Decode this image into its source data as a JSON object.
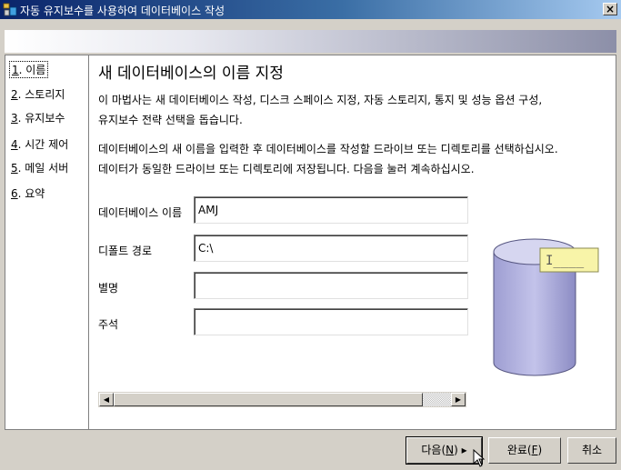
{
  "window": {
    "title": "자동 유지보수를 사용하여 데이터베이스 작성",
    "close": "×"
  },
  "nav": {
    "items": [
      {
        "num": "1",
        "label": ". 이름"
      },
      {
        "num": "2",
        "label": ". 스토리지"
      },
      {
        "num": "3",
        "label": ". 유지보수"
      },
      {
        "num": "4",
        "label": ". 시간 제어"
      },
      {
        "num": "5",
        "label": ". 메일 서버"
      },
      {
        "num": "6",
        "label": ". 요약"
      }
    ]
  },
  "main": {
    "heading": "새 데이터베이스의 이름 지정",
    "intro_line1": "이 마법사는 새 데이터베이스 작성, 디스크 스페이스 지정, 자동 스토리지, 통지 및 성능 옵션 구성,",
    "intro_line2": "유지보수 전략 선택을 돕습니다.",
    "instr_line1": "데이터베이스의 새 이름을 입력한 후 데이터베이스를 작성할 드라이브 또는 디렉토리를 선택하십시오.",
    "instr_line2": "데이터가 동일한 드라이브 또는 디렉토리에 저장됩니다. 다음을 눌러 계속하십시오.",
    "fields": {
      "db_name": {
        "label": "데이터베이스 이름",
        "value": "AMJ"
      },
      "default_path": {
        "label": "디폴트 경로",
        "value": "C:\\"
      },
      "alias": {
        "label": "별명",
        "value": ""
      },
      "comment": {
        "label": "주석",
        "value": ""
      }
    }
  },
  "buttons": {
    "next": {
      "label": "다음(",
      "mnemonic": "N",
      "suffix": ") ▸"
    },
    "finish": {
      "label": "완료(",
      "mnemonic": "F",
      "suffix": ")"
    },
    "cancel": {
      "label": "취소"
    }
  },
  "colors": {
    "title_active": "#0a246a",
    "cylinder": "#b3b3dd",
    "tooltip_bg": "#f8f4a8"
  }
}
